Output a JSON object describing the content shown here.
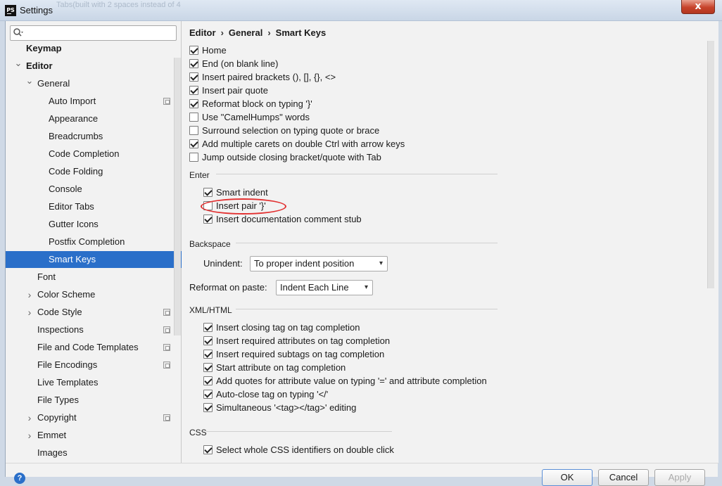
{
  "window": {
    "title": "Settings",
    "app_icon_label": "PS",
    "ghost_text": "Tabs(built with 2 spaces instead of 4",
    "close_label": "x"
  },
  "search": {
    "value": "",
    "placeholder": ""
  },
  "tree": [
    {
      "label": "Keymap",
      "bold": true,
      "indent": 1,
      "arrow": "",
      "has_icon": false,
      "selected": false
    },
    {
      "label": "Editor",
      "bold": true,
      "indent": 1,
      "arrow": "down",
      "has_icon": false,
      "selected": false
    },
    {
      "label": "General",
      "bold": false,
      "indent": 2,
      "arrow": "down",
      "has_icon": false,
      "selected": false
    },
    {
      "label": "Auto Import",
      "bold": false,
      "indent": 3,
      "arrow": "",
      "has_icon": true,
      "selected": false
    },
    {
      "label": "Appearance",
      "bold": false,
      "indent": 3,
      "arrow": "",
      "has_icon": false,
      "selected": false
    },
    {
      "label": "Breadcrumbs",
      "bold": false,
      "indent": 3,
      "arrow": "",
      "has_icon": false,
      "selected": false
    },
    {
      "label": "Code Completion",
      "bold": false,
      "indent": 3,
      "arrow": "",
      "has_icon": false,
      "selected": false
    },
    {
      "label": "Code Folding",
      "bold": false,
      "indent": 3,
      "arrow": "",
      "has_icon": false,
      "selected": false
    },
    {
      "label": "Console",
      "bold": false,
      "indent": 3,
      "arrow": "",
      "has_icon": false,
      "selected": false
    },
    {
      "label": "Editor Tabs",
      "bold": false,
      "indent": 3,
      "arrow": "",
      "has_icon": false,
      "selected": false
    },
    {
      "label": "Gutter Icons",
      "bold": false,
      "indent": 3,
      "arrow": "",
      "has_icon": false,
      "selected": false
    },
    {
      "label": "Postfix Completion",
      "bold": false,
      "indent": 3,
      "arrow": "",
      "has_icon": false,
      "selected": false
    },
    {
      "label": "Smart Keys",
      "bold": false,
      "indent": 3,
      "arrow": "",
      "has_icon": false,
      "selected": true
    },
    {
      "label": "Font",
      "bold": false,
      "indent": 2,
      "arrow": "",
      "has_icon": false,
      "selected": false
    },
    {
      "label": "Color Scheme",
      "bold": false,
      "indent": 2,
      "arrow": "right",
      "has_icon": false,
      "selected": false
    },
    {
      "label": "Code Style",
      "bold": false,
      "indent": 2,
      "arrow": "right",
      "has_icon": true,
      "selected": false
    },
    {
      "label": "Inspections",
      "bold": false,
      "indent": 2,
      "arrow": "",
      "has_icon": true,
      "selected": false
    },
    {
      "label": "File and Code Templates",
      "bold": false,
      "indent": 2,
      "arrow": "",
      "has_icon": true,
      "selected": false
    },
    {
      "label": "File Encodings",
      "bold": false,
      "indent": 2,
      "arrow": "",
      "has_icon": true,
      "selected": false
    },
    {
      "label": "Live Templates",
      "bold": false,
      "indent": 2,
      "arrow": "",
      "has_icon": false,
      "selected": false
    },
    {
      "label": "File Types",
      "bold": false,
      "indent": 2,
      "arrow": "",
      "has_icon": false,
      "selected": false
    },
    {
      "label": "Copyright",
      "bold": false,
      "indent": 2,
      "arrow": "right",
      "has_icon": true,
      "selected": false
    },
    {
      "label": "Emmet",
      "bold": false,
      "indent": 2,
      "arrow": "right",
      "has_icon": false,
      "selected": false
    },
    {
      "label": "Images",
      "bold": false,
      "indent": 2,
      "arrow": "",
      "has_icon": false,
      "selected": false
    }
  ],
  "breadcrumb": [
    "Editor",
    "General",
    "Smart Keys"
  ],
  "general_options": [
    {
      "label": "Home",
      "checked": true
    },
    {
      "label": "End (on blank line)",
      "checked": true
    },
    {
      "label": "Insert paired brackets (), [], {}, <>",
      "checked": true
    },
    {
      "label": "Insert pair quote",
      "checked": true
    },
    {
      "label": "Reformat block on typing '}'",
      "checked": true
    },
    {
      "label": "Use \"CamelHumps\" words",
      "checked": false
    },
    {
      "label": "Surround selection on typing quote or brace",
      "checked": false
    },
    {
      "label": "Add multiple carets on double Ctrl with arrow keys",
      "checked": true
    },
    {
      "label": "Jump outside closing bracket/quote with Tab",
      "checked": false
    }
  ],
  "enter": {
    "title": "Enter",
    "options": [
      {
        "label": "Smart indent",
        "checked": true
      },
      {
        "label": "Insert pair '}'",
        "checked": false
      },
      {
        "label": "Insert documentation comment stub",
        "checked": true
      }
    ]
  },
  "backspace": {
    "title": "Backspace",
    "unindent_label": "Unindent:",
    "unindent_value": "To proper indent position"
  },
  "reformat": {
    "label": "Reformat on paste:",
    "value": "Indent Each Line"
  },
  "xml": {
    "title": "XML/HTML",
    "options": [
      {
        "label": "Insert closing tag on tag completion",
        "checked": true
      },
      {
        "label": "Insert required attributes on tag completion",
        "checked": true
      },
      {
        "label": "Insert required subtags on tag completion",
        "checked": true
      },
      {
        "label": "Start attribute on tag completion",
        "checked": true
      },
      {
        "label": "Add quotes for attribute value on typing '=' and attribute completion",
        "checked": true
      },
      {
        "label": "Auto-close tag on typing '</'",
        "checked": true
      },
      {
        "label": "Simultaneous '<tag></tag>' editing",
        "checked": true
      }
    ]
  },
  "css": {
    "title": "CSS",
    "options": [
      {
        "label": "Select whole CSS identifiers on double click",
        "checked": true
      }
    ]
  },
  "buttons": {
    "ok": "OK",
    "cancel": "Cancel",
    "apply": "Apply",
    "help": "?"
  },
  "colors": {
    "selection": "#2a6fc9",
    "highlight": "#e23131",
    "close_button": "#c7432b"
  }
}
